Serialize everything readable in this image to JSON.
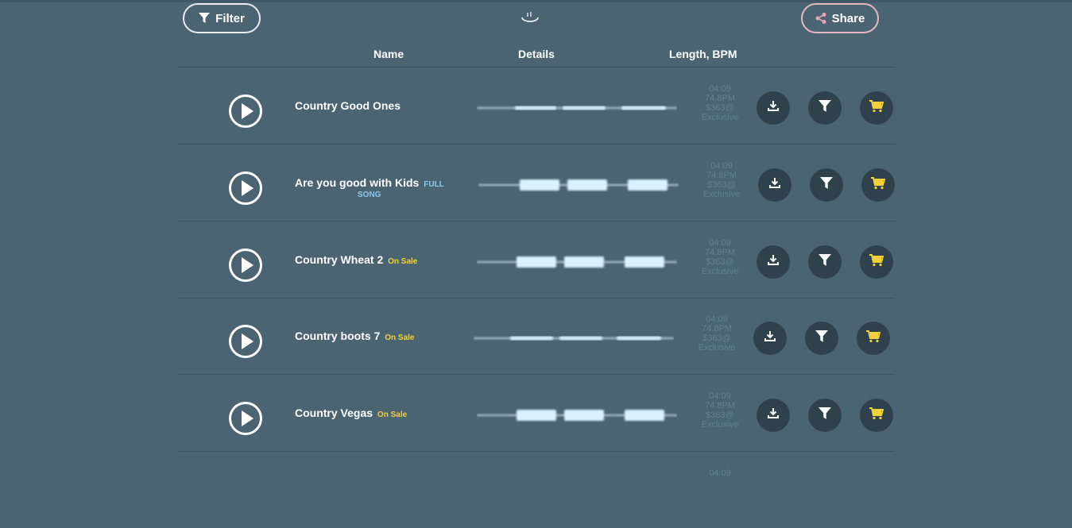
{
  "toolbar": {
    "filter_label": "Filter",
    "share_label": "Share"
  },
  "columns": {
    "name": "Name",
    "details": "Details",
    "length_bpm": "Length, BPM"
  },
  "colors": {
    "background": "#4a6472",
    "button_circle": "#2f424c",
    "cart_icon": "#f2d13a",
    "tag_on_sale": "#f2d13a",
    "tag_full_song": "#8cc8ee",
    "share_border": "#e7b7c4",
    "meta_text": "#62818f"
  },
  "icons": {
    "filter": "funnel-icon",
    "share": "share-icon",
    "loading": "spinner-icon",
    "play": "play-icon",
    "download": "download-icon",
    "cart": "cart-icon"
  },
  "tracks": [
    {
      "title": "Country Good Ones",
      "tag": "",
      "tag_line2": "",
      "length": "04:09",
      "bpm": "74.8PM",
      "price": "$363@",
      "license": "Exclusive"
    },
    {
      "title": "Are you good with Kids",
      "tag": "FULL",
      "tag_line2": "SONG",
      "length": "04:09",
      "bpm": "74.8PM",
      "price": "$363@",
      "license": "Exclusive"
    },
    {
      "title": "Country Wheat 2",
      "tag": "On Sale",
      "tag_line2": "",
      "length": "04:09",
      "bpm": "74.8PM",
      "price": "$363@",
      "license": "Exclusive"
    },
    {
      "title": "Country boots 7",
      "tag": "On Sale",
      "tag_line2": "",
      "length": "04:09",
      "bpm": "74.8PM",
      "price": "$363@",
      "license": "Exclusive"
    },
    {
      "title": "Country Vegas",
      "tag": "On Sale",
      "tag_line2": "",
      "length": "04:09",
      "bpm": "74.8PM",
      "price": "$363@",
      "license": "Exclusive"
    },
    {
      "title": "",
      "tag": "",
      "tag_line2": "",
      "length": "04:09",
      "bpm": "",
      "price": "",
      "license": ""
    }
  ]
}
